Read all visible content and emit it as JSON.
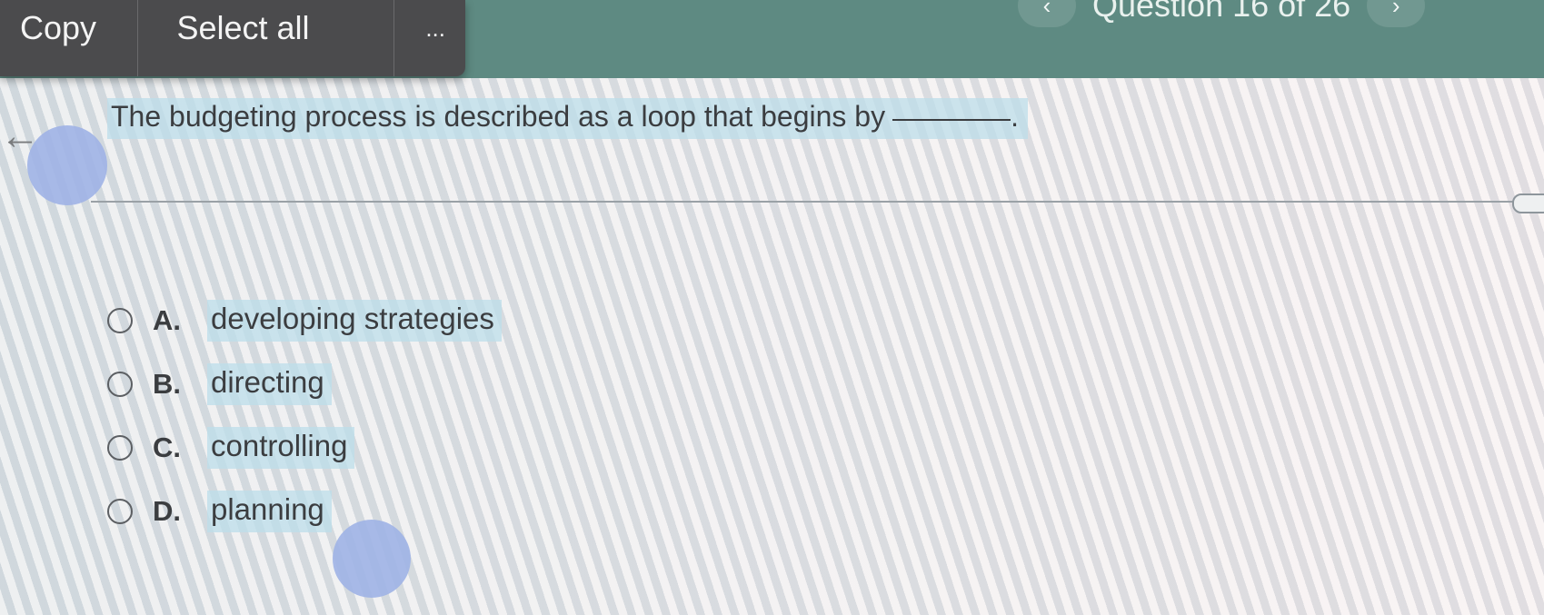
{
  "header": {
    "question_counter": "Question 16 of 26",
    "prev_icon": "chevron-left",
    "next_icon": "chevron-right",
    "prev_glyph": "‹",
    "next_glyph": "›"
  },
  "context_menu": {
    "copy": "Copy",
    "select_all": "Select all",
    "more": "..."
  },
  "nav": {
    "back_icon": "arrow-left",
    "back_glyph": "←"
  },
  "question": {
    "text": "The budgeting process is described as a loop that begins by",
    "end_punct": "."
  },
  "options": [
    {
      "letter": "A.",
      "text": "developing strategies"
    },
    {
      "letter": "B.",
      "text": "directing"
    },
    {
      "letter": "C.",
      "text": "controlling"
    },
    {
      "letter": "D.",
      "text": "planning"
    }
  ],
  "colors": {
    "header_bg": "#5e8a82",
    "menu_bg": "#4b4b4d",
    "highlight": "#bcdee9",
    "blob": "#9fb2e6"
  }
}
